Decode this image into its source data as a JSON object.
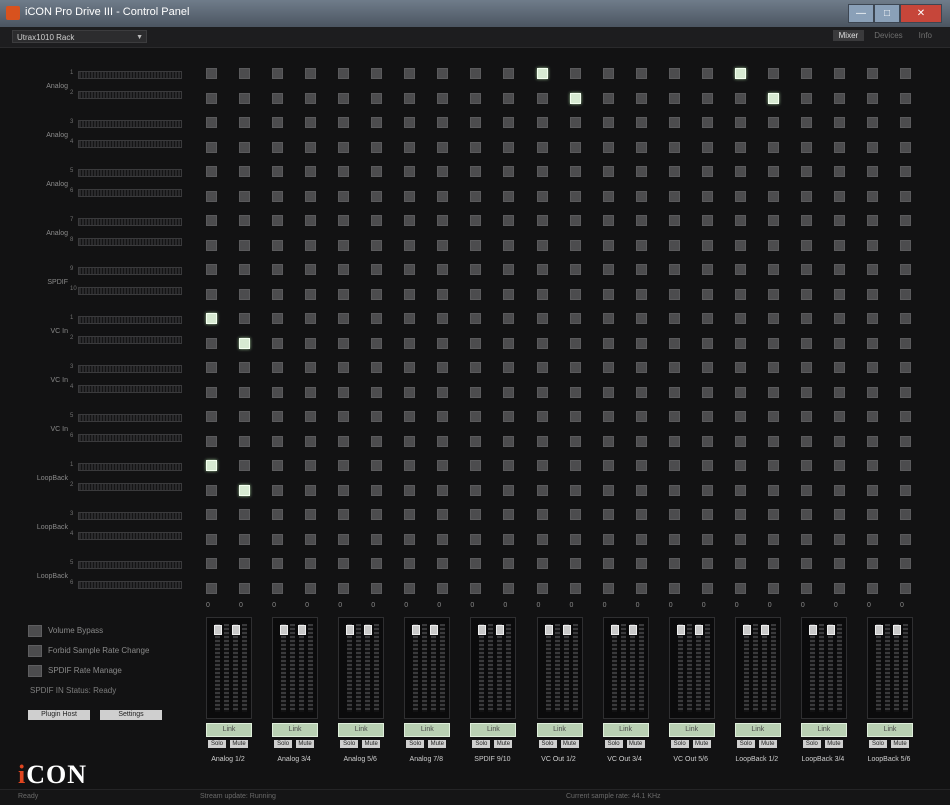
{
  "window": {
    "title": "iCON Pro Drive III - Control Panel"
  },
  "toolbar": {
    "device": "Utrax1010 Rack",
    "tabs": [
      "Mixer",
      "Devices",
      "Info"
    ]
  },
  "inputs": [
    {
      "label": "Analog",
      "channels": [
        "1",
        "2"
      ]
    },
    {
      "label": "Analog",
      "channels": [
        "3",
        "4"
      ]
    },
    {
      "label": "Analog",
      "channels": [
        "5",
        "6"
      ]
    },
    {
      "label": "Analog",
      "channels": [
        "7",
        "8"
      ]
    },
    {
      "label": "SPDIF",
      "channels": [
        "9",
        "10"
      ]
    },
    {
      "label": "VC In",
      "channels": [
        "1",
        "2"
      ]
    },
    {
      "label": "VC In",
      "channels": [
        "3",
        "4"
      ]
    },
    {
      "label": "VC In",
      "channels": [
        "5",
        "6"
      ]
    },
    {
      "label": "LoopBack",
      "channels": [
        "1",
        "2"
      ]
    },
    {
      "label": "LoopBack",
      "channels": [
        "3",
        "4"
      ]
    },
    {
      "label": "LoopBack",
      "channels": [
        "5",
        "6"
      ]
    }
  ],
  "outputs": [
    "Analog 1/2",
    "Analog 3/4",
    "Analog 5/6",
    "Analog 7/8",
    "SPDIF 9/10",
    "VC Out 1/2",
    "VC Out 3/4",
    "VC Out 5/6",
    "LoopBack 1/2",
    "LoopBack 3/4",
    "LoopBack 5/6"
  ],
  "routing_on": [
    [
      0,
      10
    ],
    [
      1,
      11
    ],
    [
      0,
      16
    ],
    [
      1,
      17
    ],
    [
      10,
      0
    ],
    [
      11,
      1
    ],
    [
      16,
      0
    ],
    [
      17,
      1
    ]
  ],
  "column_values": [
    "0",
    "0",
    "0",
    "0",
    "0",
    "0",
    "0",
    "0",
    "0",
    "0",
    "0",
    "0",
    "0",
    "0",
    "0",
    "0",
    "0",
    "0",
    "0",
    "0",
    "0",
    "0"
  ],
  "strip_buttons": {
    "link": "Link",
    "solo": "Solo",
    "mute": "Mute"
  },
  "options": [
    {
      "label": "Volume Bypass",
      "checked": false
    },
    {
      "label": "Forbid Sample Rate Change",
      "checked": false
    },
    {
      "label": "SPDIF Rate Manage",
      "checked": false
    }
  ],
  "spdif_status": "SPDIF IN Status: Ready",
  "buttons": {
    "plugin_host": "Plugin Host",
    "settings": "Settings"
  },
  "logo": {
    "i": "i",
    "rest": "CON"
  },
  "status": {
    "left": "Ready",
    "mid": "Stream update: Running",
    "right": "Current sample rate: 44.1 KHz"
  }
}
